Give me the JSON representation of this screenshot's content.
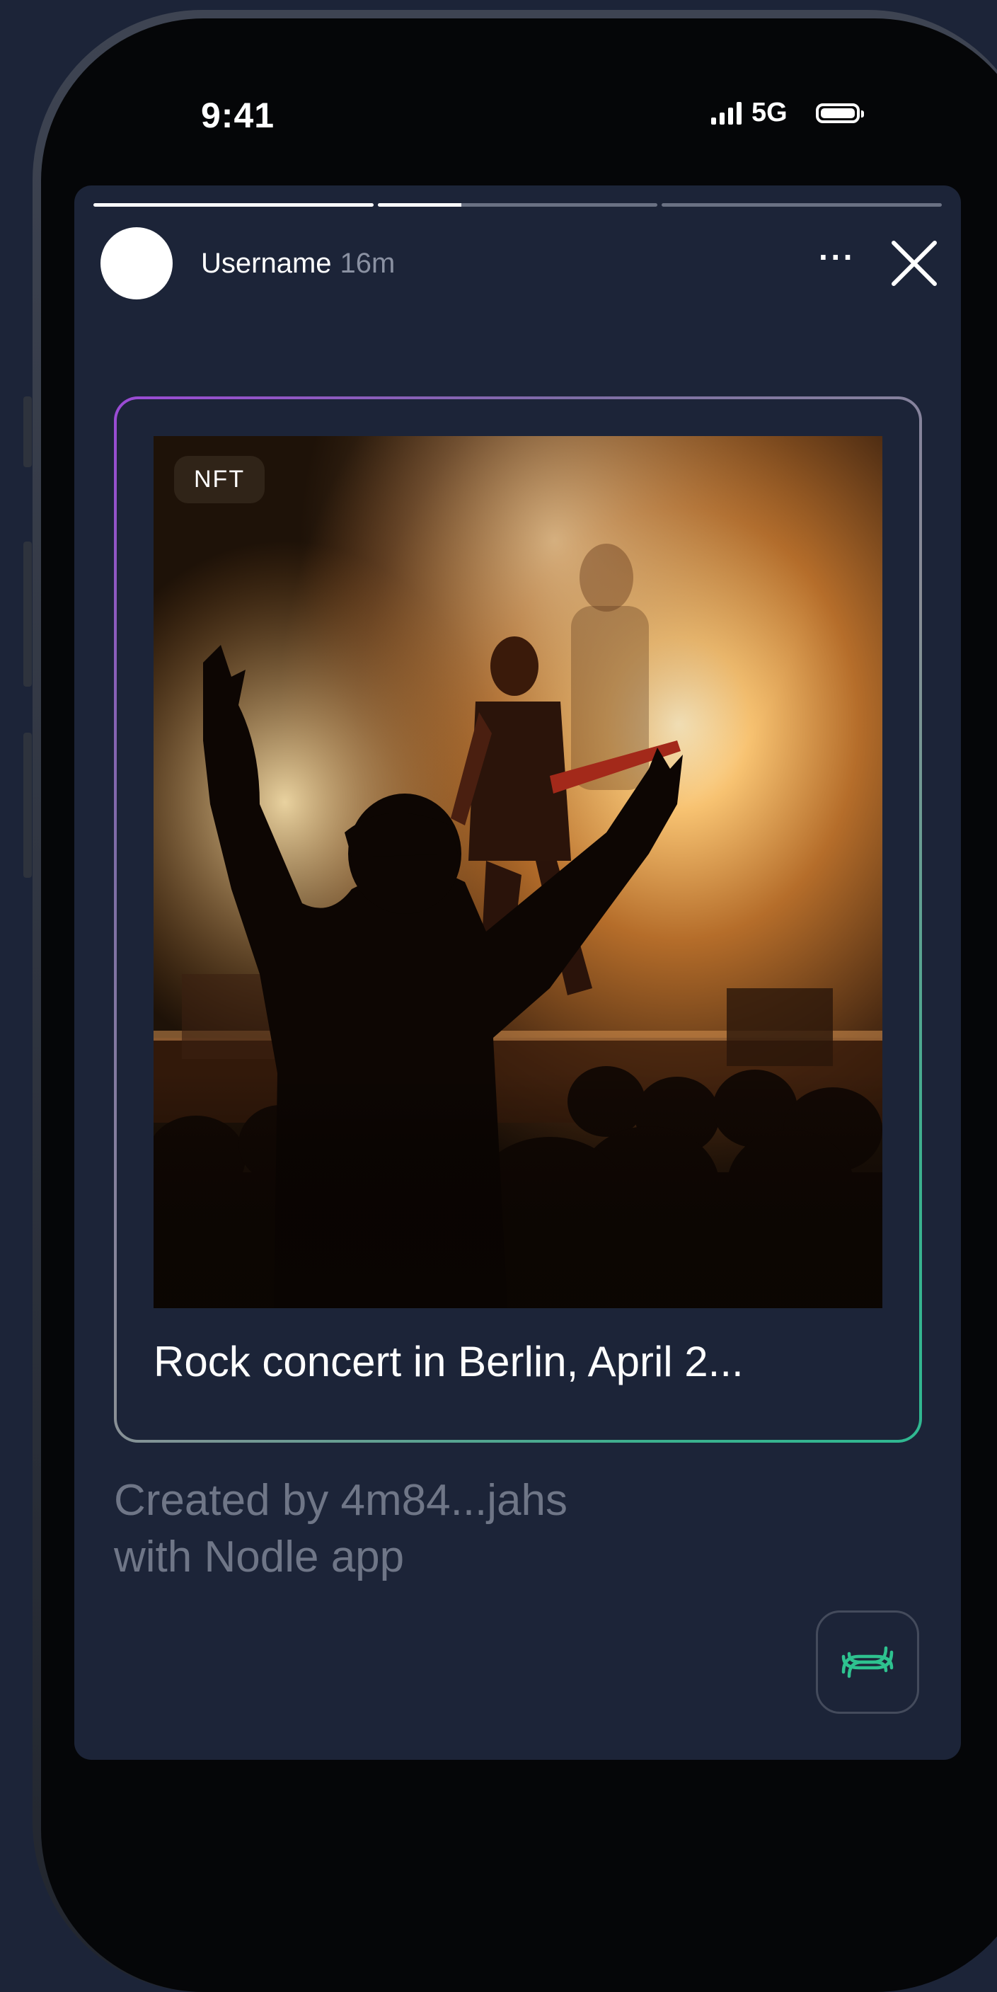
{
  "status_bar": {
    "time": "9:41",
    "network": "5G"
  },
  "story": {
    "progress": [
      1.0,
      0.3,
      0.0
    ],
    "username": "Username",
    "time_ago": "16m",
    "more_label": "···"
  },
  "nft": {
    "badge": "NFT",
    "title": "Rock concert in Berlin, April 2...",
    "gradient_colors": [
      "#9b4ad6",
      "#8a8f96",
      "#2fb891"
    ]
  },
  "creator": {
    "line1": "Created by 4m84...jahs",
    "line2": "with Nodle app"
  },
  "app_button": {
    "icon": "nodle-logo-icon",
    "accent": "#2ec28f"
  }
}
